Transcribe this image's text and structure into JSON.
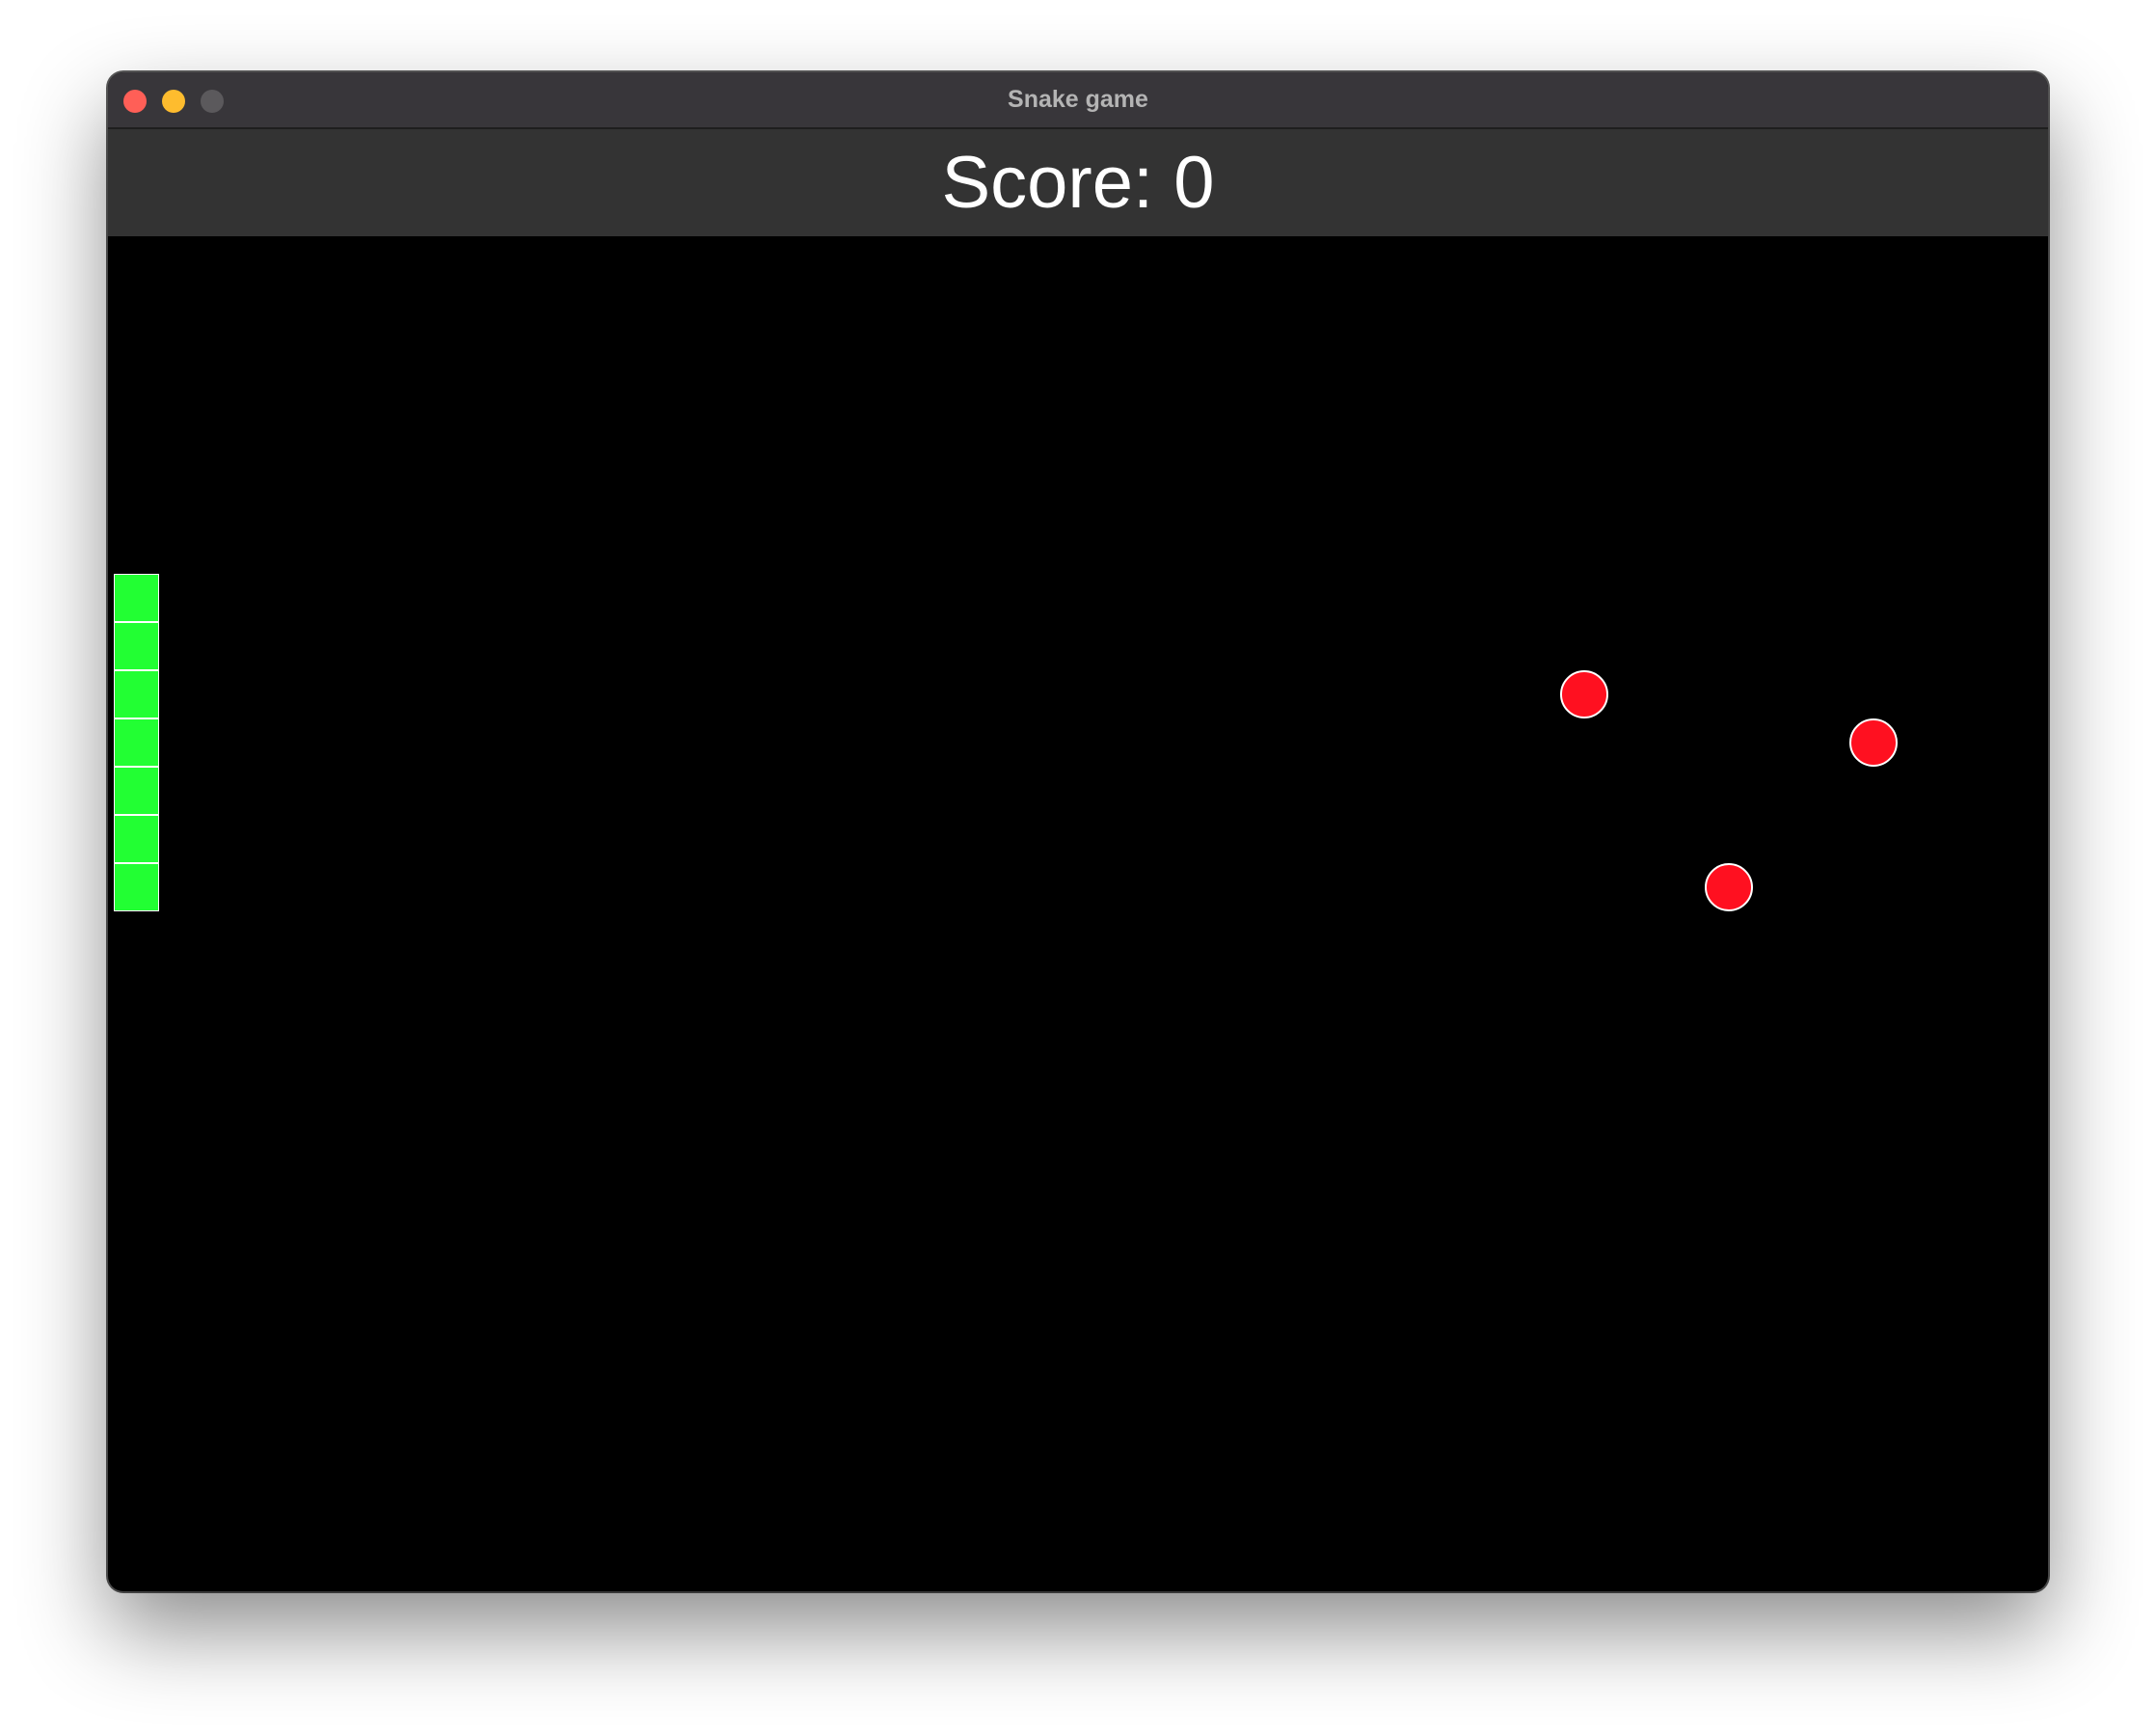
{
  "window": {
    "title": "Snake game",
    "traffic_lights": [
      {
        "name": "close",
        "color": "#ff5f57"
      },
      {
        "name": "minimize",
        "color": "#febc2e"
      },
      {
        "name": "zoom",
        "color": "#5b595c"
      }
    ]
  },
  "score": {
    "text": "Score: 0"
  },
  "game": {
    "background": "#000000",
    "snake": {
      "color": "#22ff33",
      "segments": [
        {
          "col": 0,
          "row": 7
        },
        {
          "col": 0,
          "row": 8
        },
        {
          "col": 0,
          "row": 9
        },
        {
          "col": 0,
          "row": 10
        },
        {
          "col": 0,
          "row": 11
        },
        {
          "col": 0,
          "row": 12
        },
        {
          "col": 0,
          "row": 13
        }
      ]
    },
    "food": {
      "color": "#ff1020",
      "items": [
        {
          "col": 30,
          "row": 9
        },
        {
          "col": 36,
          "row": 10
        },
        {
          "col": 33,
          "row": 13
        }
      ]
    }
  }
}
